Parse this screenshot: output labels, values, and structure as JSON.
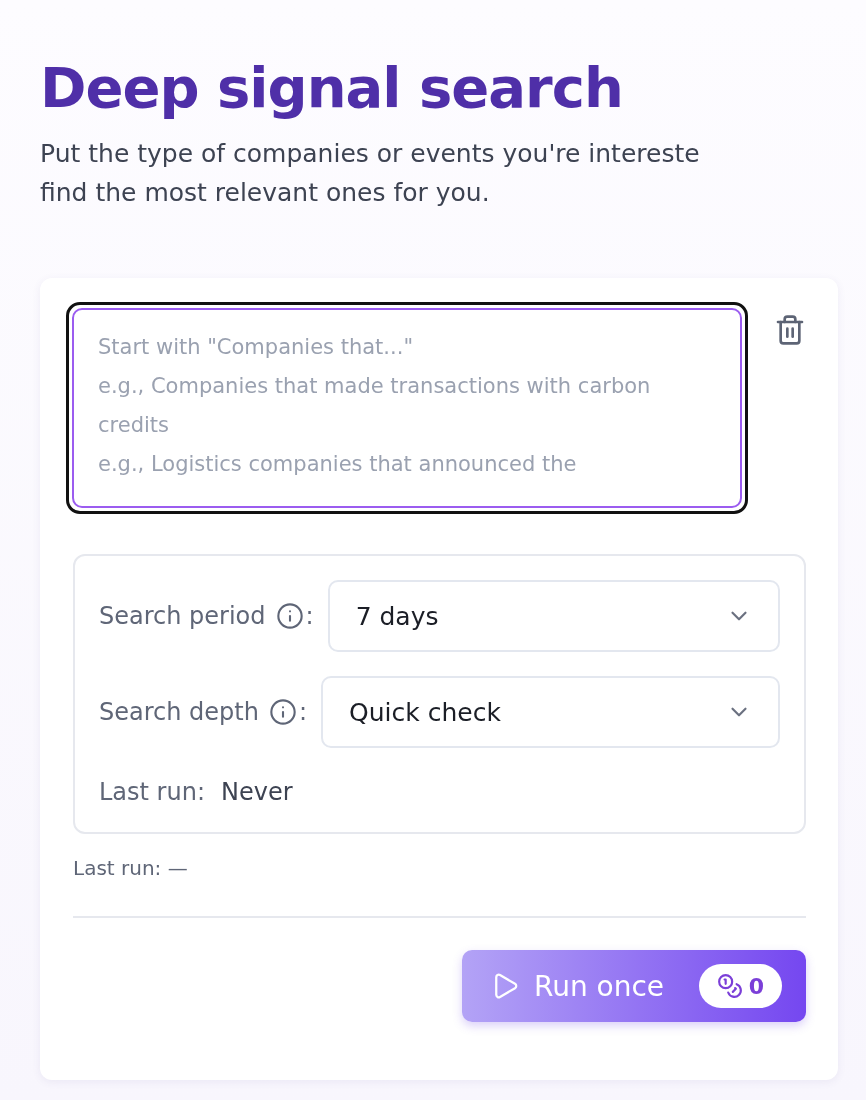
{
  "title": "Deep signal search",
  "subtitle_lines": [
    "Put the type of companies or events you're intereste",
    "find the most relevant ones for you."
  ],
  "query": {
    "placeholder": "Start with \"Companies that...\"\ne.g., Companies that made transactions with carbon credits\ne.g., Logistics companies that announced the",
    "focused": true
  },
  "settings": [
    {
      "label": "Search period",
      "suffix": ":",
      "value": "7 days"
    },
    {
      "label": "Search depth",
      "suffix": ":",
      "value": "Quick check"
    }
  ],
  "last_run": {
    "label": "Last run:",
    "value": "Never"
  },
  "footer_last_run": "Last run: —",
  "run_button": {
    "label": "Run once",
    "credits": "0"
  }
}
